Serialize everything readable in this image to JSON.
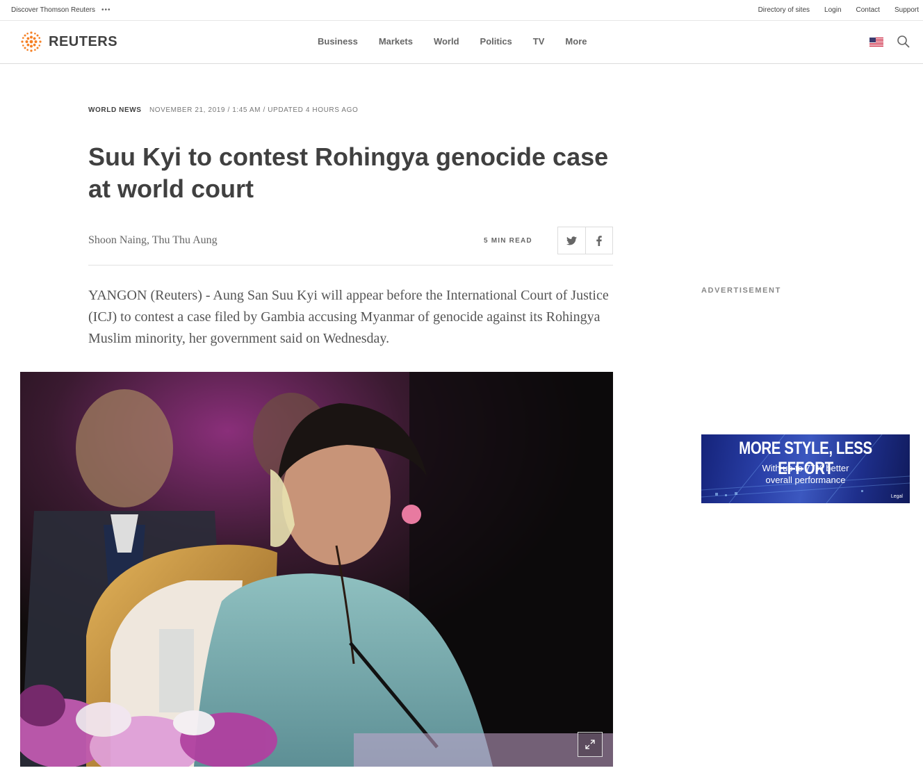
{
  "utility": {
    "discover": "Discover Thomson Reuters",
    "links": [
      "Directory of sites",
      "Login",
      "Contact",
      "Support"
    ]
  },
  "header": {
    "logo_text": "REUTERS",
    "nav": [
      "Business",
      "Markets",
      "World",
      "Politics",
      "TV",
      "More"
    ],
    "icons": [
      "us-flag-icon",
      "search-icon"
    ]
  },
  "article": {
    "section": "WORLD NEWS",
    "dateline": "NOVEMBER 21, 2019 / 1:45 AM / UPDATED 4 HOURS AGO",
    "headline": "Suu Kyi to contest Rohingya genocide case at world court",
    "byline": "Shoon Naing, Thu Thu Aung",
    "read_time": "5 MIN READ",
    "share_icons": [
      "twitter-icon",
      "facebook-icon"
    ],
    "lede": "YANGON (Reuters) - Aung San Suu Kyi will appear before the International Court of Justice (ICJ) to contest a case filed by Gambia accusing Myanmar of genocide against its Rohingya Muslim minority, her government said on Wednesday."
  },
  "sidebar": {
    "ad_label": "ADVERTISEMENT",
    "ad_headline": "MORE STYLE, LESS EFFORT",
    "ad_line1": "With up to 77% better",
    "ad_line2": "overall performance",
    "ad_brand": "Legal"
  },
  "colors": {
    "logo_orange": "#f58025",
    "text_dark": "#404040",
    "text_muted": "#666666"
  }
}
